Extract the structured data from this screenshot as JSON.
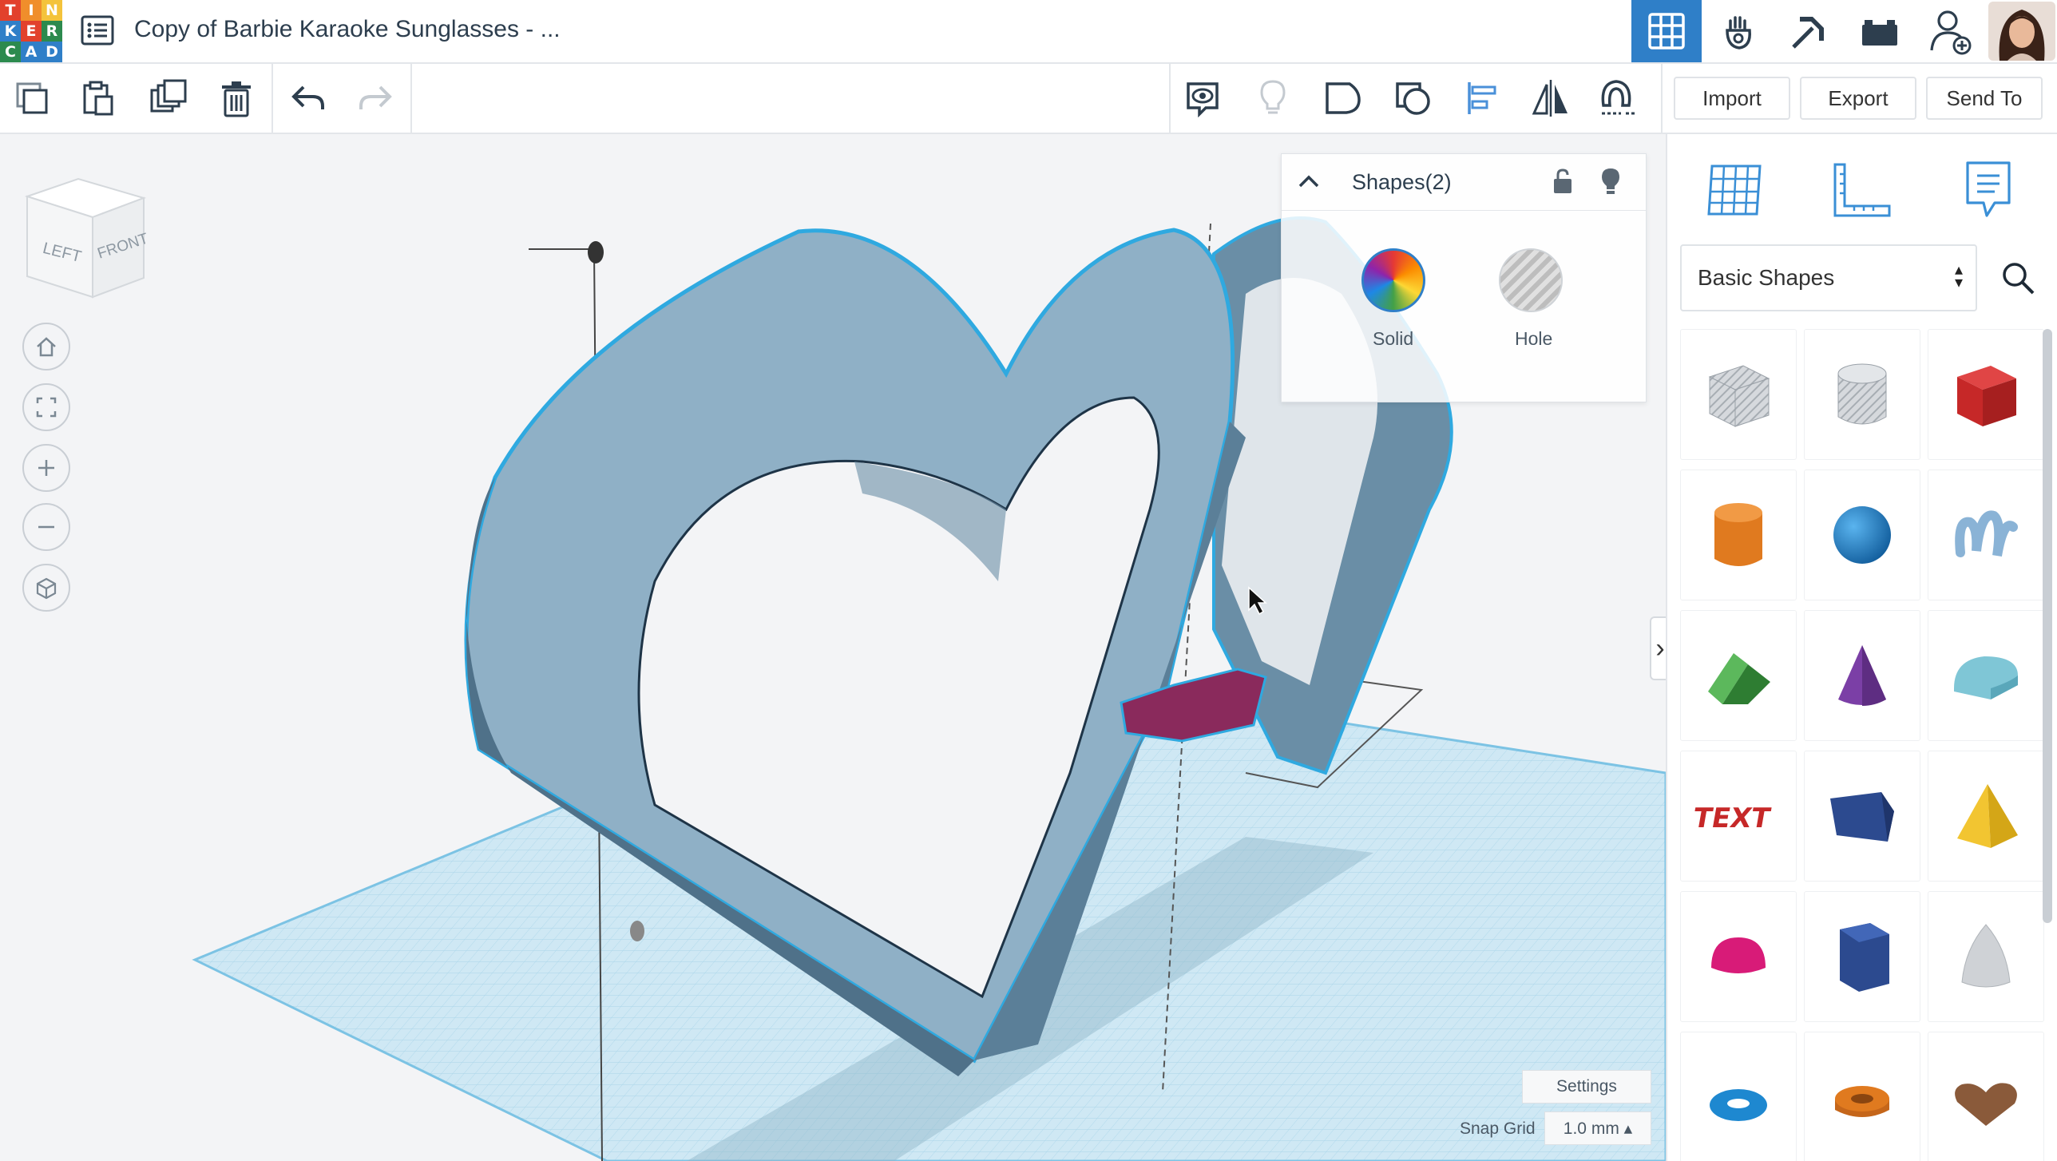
{
  "app": {
    "logo_letters": [
      "T",
      "I",
      "N",
      "K",
      "E",
      "R",
      "C",
      "A",
      "D"
    ],
    "logo_colors": [
      "#e2412c",
      "#f08e2b",
      "#f4c33b",
      "#2f7fc8",
      "#e2412c",
      "#2c8a4e",
      "#2c8a4e",
      "#2f7fc8",
      "#2f7fc8"
    ],
    "design_title": "Copy of Barbie Karaoke Sunglasses - ...",
    "accent_color": "#2f7fc8"
  },
  "topbar": {
    "nav_icons": [
      "grid-3d-icon",
      "simulation-icon",
      "minecraft-pickaxe-icon",
      "bricks-icon",
      "add-user-icon"
    ],
    "active_nav": "grid-3d-icon"
  },
  "toolbar": {
    "edit_icons": [
      "copy-icon",
      "paste-icon",
      "duplicate-icon",
      "delete-icon",
      "undo-icon",
      "redo-icon"
    ],
    "view_icons": [
      "notes-visibility-icon",
      "show-all-bulb-icon",
      "group-icon",
      "ungroup-icon",
      "align-icon",
      "mirror-icon",
      "cruise-magnet-icon"
    ],
    "import_label": "Import",
    "export_label": "Export",
    "send_to_label": "Send To"
  },
  "viewport": {
    "viewcube_left": "LEFT",
    "viewcube_front": "FRONT",
    "controls": [
      "home-icon",
      "fit-all-icon",
      "zoom-in-icon",
      "zoom-out-icon",
      "perspective-icon"
    ],
    "settings_label": "Settings",
    "snap_grid_label": "Snap Grid",
    "snap_grid_value": "1.0 mm ▴"
  },
  "inspector": {
    "title": "Shapes(2)",
    "solid_label": "Solid",
    "hole_label": "Hole"
  },
  "sidebar": {
    "tabs": [
      "workplane-icon",
      "ruler-icon",
      "notes-icon"
    ],
    "category": "Basic Shapes",
    "shapes": [
      {
        "name": "box-hole",
        "color": "#b9bfc5"
      },
      {
        "name": "cylinder-hole",
        "color": "#b9bfc5"
      },
      {
        "name": "box",
        "color": "#d32f2f"
      },
      {
        "name": "cylinder",
        "color": "#e07a1f"
      },
      {
        "name": "sphere",
        "color": "#1e88d0"
      },
      {
        "name": "scribble",
        "color": "#8ab3d6"
      },
      {
        "name": "roof",
        "color": "#43a047"
      },
      {
        "name": "cone",
        "color": "#7b3fa6"
      },
      {
        "name": "round-roof",
        "color": "#7fc6d6"
      },
      {
        "name": "text",
        "color": "#c62828"
      },
      {
        "name": "wedge",
        "color": "#2c4a8f"
      },
      {
        "name": "pyramid",
        "color": "#f2c531"
      },
      {
        "name": "half-sphere",
        "color": "#d81b78"
      },
      {
        "name": "polygon",
        "color": "#2c4a8f"
      },
      {
        "name": "paraboloid",
        "color": "#cfd2d6"
      },
      {
        "name": "torus",
        "color": "#1e88d0"
      },
      {
        "name": "tube",
        "color": "#e07a1f"
      },
      {
        "name": "heart",
        "color": "#8a5a3a"
      }
    ]
  }
}
